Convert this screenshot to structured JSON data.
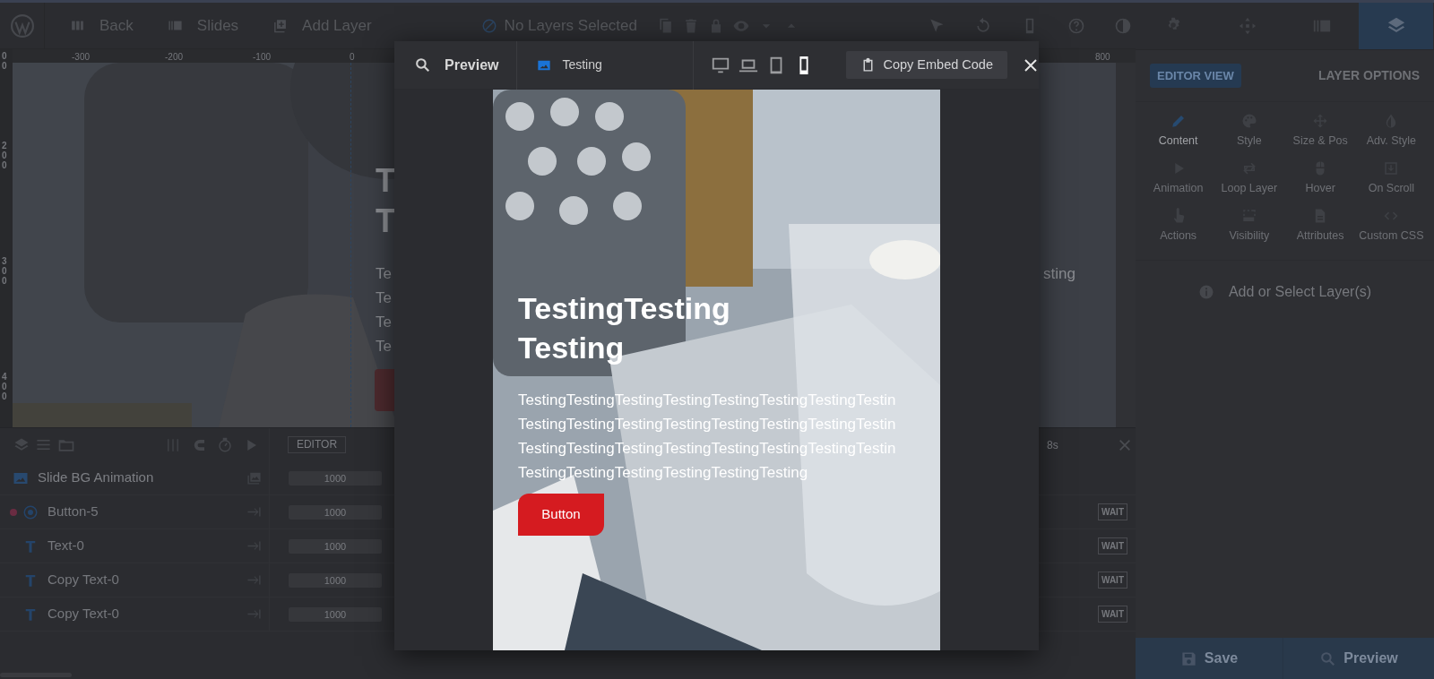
{
  "top_bar": {
    "nav": [
      {
        "kind": "back",
        "label": "Back"
      },
      {
        "kind": "slides",
        "label": "Slides"
      },
      {
        "kind": "add",
        "label": "Add Layer"
      }
    ],
    "selection": "No Layers Selected"
  },
  "side_tabs": [
    {
      "kind": "settings",
      "selected": false
    },
    {
      "kind": "navigation",
      "selected": false
    },
    {
      "kind": "slides",
      "selected": false
    },
    {
      "kind": "layers",
      "selected": true
    }
  ],
  "ruler": {
    "x_ticks": [
      "-300",
      "-200",
      "-100",
      "0",
      "800"
    ],
    "y_ticks": [
      "00",
      "200",
      "300",
      "400"
    ]
  },
  "canvas": {
    "title_lines": [
      "T",
      "T"
    ],
    "text_lines": [
      "Te",
      "Te",
      "Te",
      "Te"
    ],
    "right_text": "sting"
  },
  "preview": {
    "title": "Preview",
    "slide": "Testing",
    "devices": [
      {
        "kind": "desktop",
        "selected": false
      },
      {
        "kind": "laptop",
        "selected": false
      },
      {
        "kind": "tablet",
        "selected": false
      },
      {
        "kind": "phone",
        "selected": true
      }
    ],
    "copy_button": "Copy Embed Code",
    "heading_lines": [
      "TestingTesting",
      "Testing"
    ],
    "text_lines": [
      "TestingTestingTestingTestingTestingTestingTestingTestin",
      "TestingTestingTestingTestingTestingTestingTestingTestin",
      "TestingTestingTestingTestingTestingTestingTestingTestin",
      "TestingTestingTestingTestingTestingTesting"
    ],
    "button": "Button"
  },
  "timeline": {
    "mode": "EDITOR",
    "time_label": "8s",
    "layers": [
      {
        "kind": "background",
        "name": "Slide BG Animation",
        "duration": "1000",
        "marked": false
      },
      {
        "kind": "button",
        "name": "Button-5",
        "duration": "1000",
        "marked": true,
        "wait": "WAIT"
      },
      {
        "kind": "text",
        "name": "Text-0",
        "duration": "1000",
        "marked": false,
        "wait": "WAIT"
      },
      {
        "kind": "text",
        "name": "Copy Text-0",
        "duration": "1000",
        "marked": false,
        "wait": "WAIT"
      },
      {
        "kind": "text",
        "name": "Copy Text-0",
        "duration": "1000",
        "marked": false,
        "wait": "WAIT"
      }
    ]
  },
  "panel": {
    "view_button": "EDITOR VIEW",
    "options_title": "LAYER OPTIONS",
    "options": [
      {
        "kind": "content",
        "label": "Content",
        "selected": true
      },
      {
        "kind": "style",
        "label": "Style",
        "selected": false
      },
      {
        "kind": "size",
        "label": "Size & Pos",
        "selected": false
      },
      {
        "kind": "adv",
        "label": "Adv. Style",
        "selected": false
      },
      {
        "kind": "animation",
        "label": "Animation",
        "selected": false
      },
      {
        "kind": "loop",
        "label": "Loop Layer",
        "selected": false
      },
      {
        "kind": "hover",
        "label": "Hover",
        "selected": false
      },
      {
        "kind": "scroll",
        "label": "On Scroll",
        "selected": false
      },
      {
        "kind": "actions",
        "label": "Actions",
        "selected": false
      },
      {
        "kind": "visibility",
        "label": "Visibility",
        "selected": false
      },
      {
        "kind": "attributes",
        "label": "Attributes",
        "selected": false
      },
      {
        "kind": "css",
        "label": "Custom CSS",
        "selected": false
      }
    ],
    "empty_message": "Add or Select Layer(s)",
    "save": "Save",
    "preview": "Preview"
  }
}
